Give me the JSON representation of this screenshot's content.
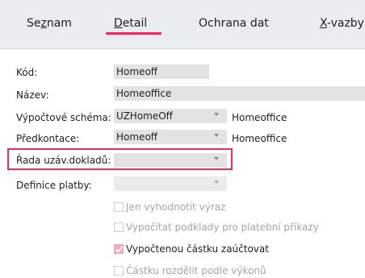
{
  "tabs": {
    "seznam": {
      "pre": "Se",
      "key": "z",
      "post": "nam"
    },
    "detail": {
      "pre": "",
      "key": "D",
      "post": "etail"
    },
    "ochrana": {
      "label": "Ochrana dat"
    },
    "xvazby": {
      "pre": "",
      "key": "X",
      "post": "-vazby"
    }
  },
  "form": {
    "kod": {
      "label": "Kód:",
      "value": "Homeoff"
    },
    "nazev": {
      "label": "Název:",
      "value": "Homeoffice"
    },
    "schema": {
      "label": "Výpočtové schéma:",
      "value": "UZHomeOff",
      "side": "Homeoffice"
    },
    "predkontace": {
      "label": "Předkontace:",
      "value": "Homeoff",
      "side": "Homeoffice"
    },
    "rada": {
      "label": "Řada uzáv.dokladů:",
      "value": ""
    },
    "platba": {
      "label": "Definice platby:",
      "value": ""
    }
  },
  "checks": {
    "vyhodnotit": {
      "label": "Jen vyhodnotit výraz",
      "checked": false,
      "enabled": false
    },
    "podklady": {
      "label": "Vypočítat podklady pro platební příkazy",
      "checked": false,
      "enabled": false
    },
    "zauctovat": {
      "label": "Vypočtenou částku zaúčtovat",
      "checked": true,
      "enabled": true
    },
    "rozdelit": {
      "label": "Částku rozdělit podle výkonů",
      "checked": false,
      "enabled": false
    }
  },
  "colors": {
    "accent": "#e0305e",
    "tabbar": "#e9ecf0",
    "field": "#e3e3e3"
  }
}
